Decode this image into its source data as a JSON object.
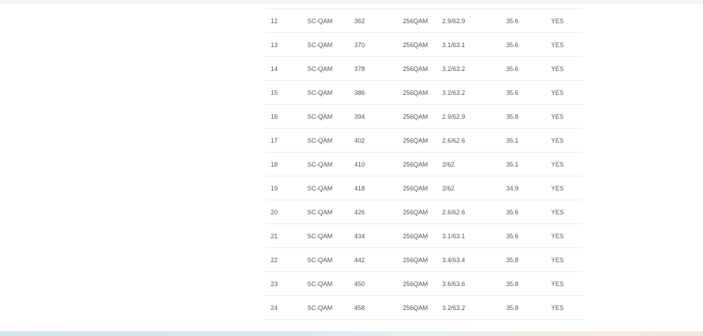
{
  "channels": [
    {
      "id": "12",
      "type": "SC-QAM",
      "frequency": "362",
      "modulation": "256QAM",
      "power": "2.9/62.9",
      "snr": "35.6",
      "locked": "YES"
    },
    {
      "id": "13",
      "type": "SC-QAM",
      "frequency": "370",
      "modulation": "256QAM",
      "power": "3.1/63.1",
      "snr": "35.6",
      "locked": "YES"
    },
    {
      "id": "14",
      "type": "SC-QAM",
      "frequency": "378",
      "modulation": "256QAM",
      "power": "3.2/63.2",
      "snr": "35.6",
      "locked": "YES"
    },
    {
      "id": "15",
      "type": "SC-QAM",
      "frequency": "386",
      "modulation": "256QAM",
      "power": "3.2/63.2",
      "snr": "35.6",
      "locked": "YES"
    },
    {
      "id": "16",
      "type": "SC-QAM",
      "frequency": "394",
      "modulation": "256QAM",
      "power": "2.9/62.9",
      "snr": "35.8",
      "locked": "YES"
    },
    {
      "id": "17",
      "type": "SC-QAM",
      "frequency": "402",
      "modulation": "256QAM",
      "power": "2.6/62.6",
      "snr": "35.1",
      "locked": "YES"
    },
    {
      "id": "18",
      "type": "SC-QAM",
      "frequency": "410",
      "modulation": "256QAM",
      "power": "2/62",
      "snr": "35.1",
      "locked": "YES"
    },
    {
      "id": "19",
      "type": "SC-QAM",
      "frequency": "418",
      "modulation": "256QAM",
      "power": "2/62",
      "snr": "34.9",
      "locked": "YES"
    },
    {
      "id": "20",
      "type": "SC-QAM",
      "frequency": "426",
      "modulation": "256QAM",
      "power": "2.6/62.6",
      "snr": "35.6",
      "locked": "YES"
    },
    {
      "id": "21",
      "type": "SC-QAM",
      "frequency": "434",
      "modulation": "256QAM",
      "power": "3.1/63.1",
      "snr": "35.6",
      "locked": "YES"
    },
    {
      "id": "22",
      "type": "SC-QAM",
      "frequency": "442",
      "modulation": "256QAM",
      "power": "3.4/63.4",
      "snr": "35.8",
      "locked": "YES"
    },
    {
      "id": "23",
      "type": "SC-QAM",
      "frequency": "450",
      "modulation": "256QAM",
      "power": "3.6/63.6",
      "snr": "35.8",
      "locked": "YES"
    },
    {
      "id": "24",
      "type": "SC-QAM",
      "frequency": "458",
      "modulation": "256QAM",
      "power": "3.2/63.2",
      "snr": "35.8",
      "locked": "YES"
    }
  ]
}
